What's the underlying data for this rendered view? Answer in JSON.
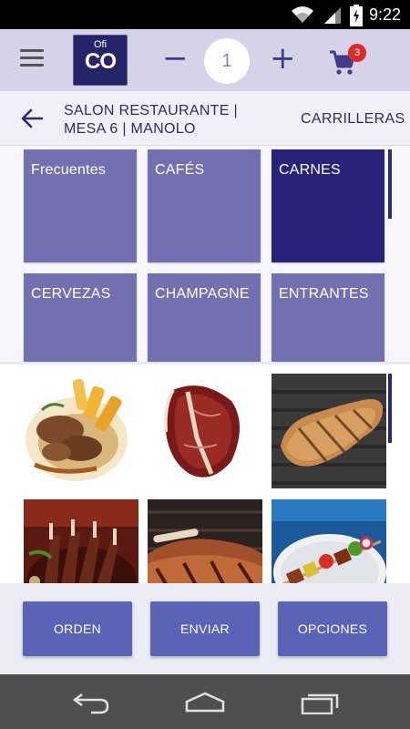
{
  "status_bar": {
    "time": "9:22",
    "icons": [
      "wifi-icon",
      "signal-icon",
      "battery-icon"
    ]
  },
  "app_bar": {
    "menu_icon": "hamburger-icon",
    "logo": {
      "top": "Ofi",
      "main": "CO"
    },
    "quantity": {
      "minus": "−",
      "value": "1",
      "plus": "+"
    },
    "cart": {
      "icon": "cart-icon",
      "count": "3",
      "badge_color": "#e02a2a"
    }
  },
  "sub_header": {
    "back_icon": "arrow-left-icon",
    "location_line1": "SALON RESTAURANTE |",
    "location_line2": "MESA 6 | MANOLO",
    "current_item": "CARRILLERAS"
  },
  "categories": [
    {
      "label": "Frecuentes",
      "selected": false
    },
    {
      "label": "CAFÉS",
      "selected": false
    },
    {
      "label": "CARNES",
      "selected": true
    },
    {
      "label": "CERVEZAS",
      "selected": false
    },
    {
      "label": "CHAMPAGNE",
      "selected": false
    },
    {
      "label": "ENTRANTES",
      "selected": false
    }
  ],
  "products": [
    {
      "image": "carrilleras-photo"
    },
    {
      "image": "chuleton-photo"
    },
    {
      "image": "grilled-steak-photo"
    },
    {
      "image": "lamb-ribs-photo"
    },
    {
      "image": "ribeye-photo"
    },
    {
      "image": "skewers-photo"
    }
  ],
  "actions": {
    "orden": "ORDEN",
    "enviar": "ENVIAR",
    "opciones": "OPCIONES"
  },
  "nav_bar": {
    "icons": [
      "back-nav-icon",
      "home-nav-icon",
      "recents-nav-icon"
    ]
  },
  "colors": {
    "primary_dark": "#28237a",
    "tile": "#7270b1",
    "button": "#5a63b6",
    "app_bar": "#d6d3e9"
  }
}
